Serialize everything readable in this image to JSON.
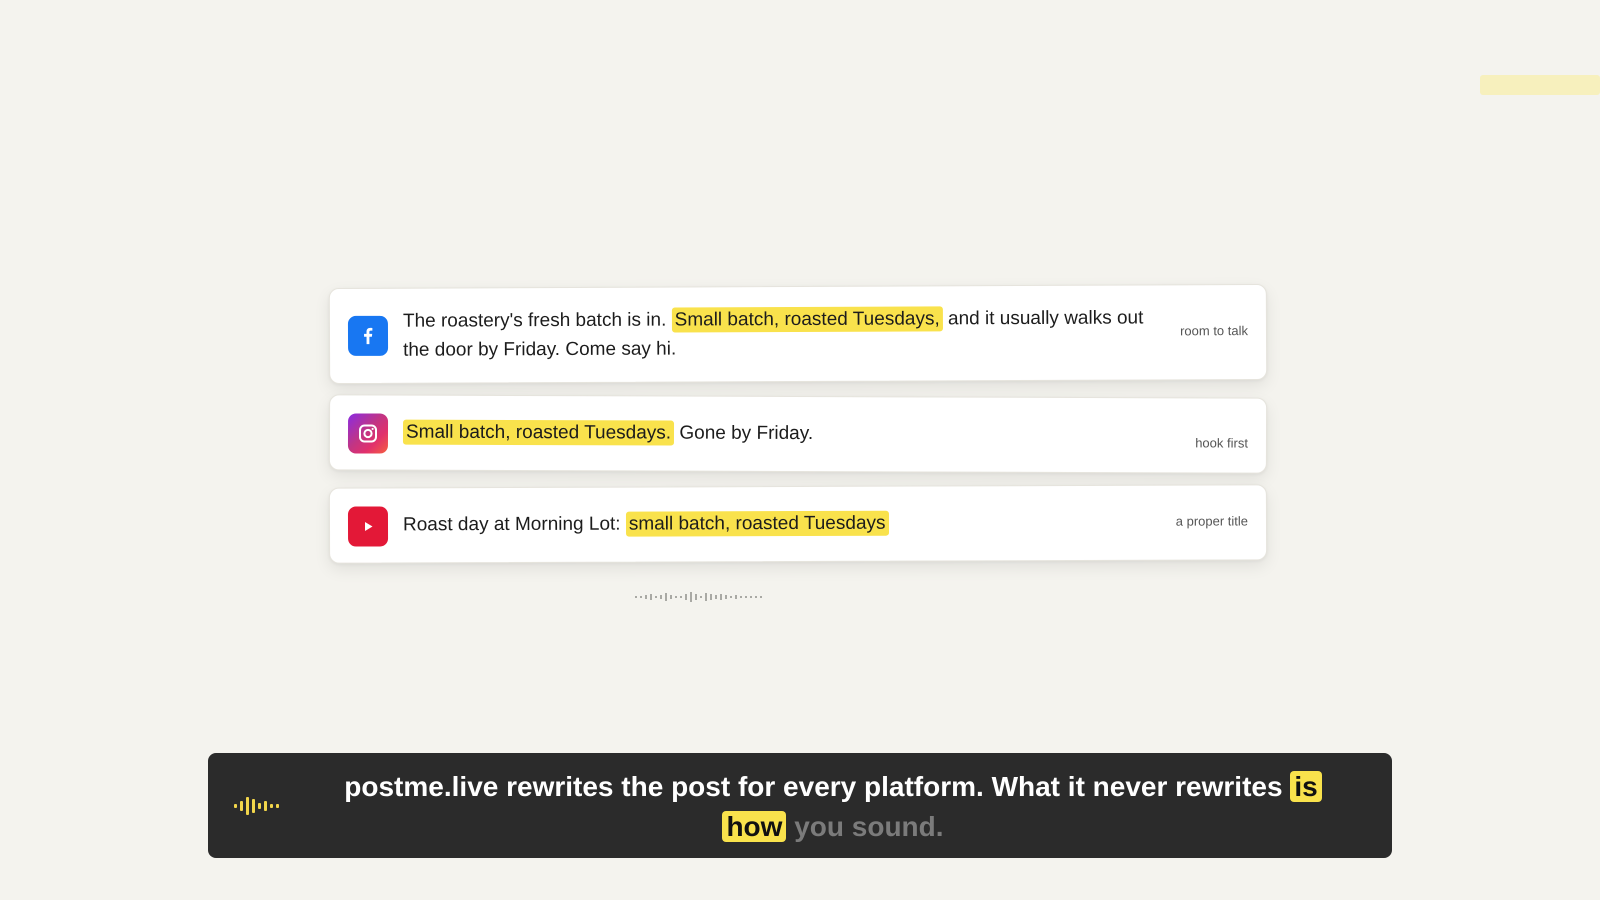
{
  "colors": {
    "background": "#f4f3ee",
    "highlight": "#f9e24c",
    "facebook": "#1877f2",
    "youtube": "#e31837",
    "caption_bar": "#2b2b2b"
  },
  "posts": [
    {
      "platform_icon": "facebook-icon",
      "text_before": "The roastery's fresh batch is in.",
      "highlight": "Small batch, roasted Tuesdays,",
      "text_after": "and it usually walks out the door by Friday. Come say hi.",
      "tone": "room to talk"
    },
    {
      "platform_icon": "instagram-icon",
      "text_before": "",
      "highlight": "Small batch, roasted Tuesdays.",
      "text_after": "Gone by Friday.",
      "tone": "hook first"
    },
    {
      "platform_icon": "youtube-icon",
      "text_before": "Roast day at Morning Lot:",
      "highlight": "small batch, roasted Tuesdays",
      "text_after": "",
      "tone": "a proper title"
    }
  ],
  "caption": {
    "icon": "audio-waveform-icon",
    "text_main": "postme.live rewrites the post for every platform. What it never rewrites",
    "word_is": "is",
    "word_how": "how",
    "text_dim": "you sound."
  }
}
